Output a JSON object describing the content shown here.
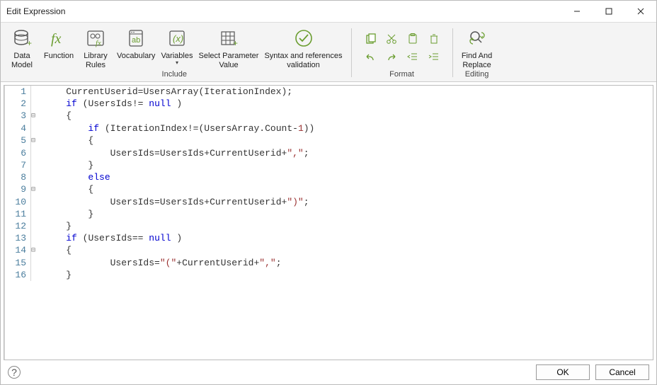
{
  "window": {
    "title": "Edit Expression"
  },
  "include_group": {
    "label": "Include",
    "buttons": {
      "dataModel": "Data\nModel",
      "func": "Function",
      "libRules": "Library\nRules",
      "vocab": "Vocabulary",
      "variables": "Variables",
      "selectParam": "Select Parameter\nValue",
      "syntaxRef": "Syntax and references\nvalidation"
    }
  },
  "format_group": {
    "label": "Format"
  },
  "editing_group": {
    "label": "Editing",
    "findReplace": "Find And\nReplace"
  },
  "footer": {
    "ok": "OK",
    "cancel": "Cancel"
  },
  "code_lines": [
    {
      "n": 1,
      "fold": "",
      "tokens": [
        [
          "id",
          "    CurrentUserid"
        ],
        [
          "punc",
          "="
        ],
        [
          "id",
          "UsersArray"
        ],
        [
          "punc",
          "("
        ],
        [
          "id",
          "IterationIndex"
        ],
        [
          "punc",
          ")"
        ],
        [
          "punc",
          ";"
        ]
      ]
    },
    {
      "n": 2,
      "fold": "",
      "tokens": [
        [
          "id",
          "    "
        ],
        [
          "kw",
          "if"
        ],
        [
          "id",
          " "
        ],
        [
          "punc",
          "("
        ],
        [
          "id",
          "UsersIds"
        ],
        [
          "punc",
          "!="
        ],
        [
          "id",
          " "
        ],
        [
          "kw",
          "null"
        ],
        [
          "id",
          " "
        ],
        [
          "punc",
          ")"
        ]
      ]
    },
    {
      "n": 3,
      "fold": "⊟",
      "tokens": [
        [
          "punc",
          "    {"
        ]
      ]
    },
    {
      "n": 4,
      "fold": "",
      "tokens": [
        [
          "id",
          "        "
        ],
        [
          "kw",
          "if"
        ],
        [
          "id",
          " "
        ],
        [
          "punc",
          "("
        ],
        [
          "id",
          "IterationIndex"
        ],
        [
          "punc",
          "!=("
        ],
        [
          "id",
          "UsersArray"
        ],
        [
          "punc",
          "."
        ],
        [
          "id",
          "Count"
        ],
        [
          "punc",
          "-"
        ],
        [
          "num",
          "1"
        ],
        [
          "punc",
          "))"
        ]
      ]
    },
    {
      "n": 5,
      "fold": "⊟",
      "tokens": [
        [
          "punc",
          "        {"
        ]
      ]
    },
    {
      "n": 6,
      "fold": "",
      "tokens": [
        [
          "id",
          "            UsersIds"
        ],
        [
          "punc",
          "="
        ],
        [
          "id",
          "UsersIds"
        ],
        [
          "punc",
          "+"
        ],
        [
          "id",
          "CurrentUserid"
        ],
        [
          "punc",
          "+"
        ],
        [
          "str",
          "\",\""
        ],
        [
          "punc",
          ";"
        ]
      ]
    },
    {
      "n": 7,
      "fold": "",
      "tokens": [
        [
          "punc",
          "        }"
        ]
      ]
    },
    {
      "n": 8,
      "fold": "",
      "tokens": [
        [
          "id",
          "        "
        ],
        [
          "kw",
          "else"
        ]
      ]
    },
    {
      "n": 9,
      "fold": "⊟",
      "tokens": [
        [
          "punc",
          "        {"
        ]
      ]
    },
    {
      "n": 10,
      "fold": "",
      "tokens": [
        [
          "id",
          "            UsersIds"
        ],
        [
          "punc",
          "="
        ],
        [
          "id",
          "UsersIds"
        ],
        [
          "punc",
          "+"
        ],
        [
          "id",
          "CurrentUserid"
        ],
        [
          "punc",
          "+"
        ],
        [
          "str",
          "\")\""
        ],
        [
          "punc",
          ";"
        ]
      ]
    },
    {
      "n": 11,
      "fold": "",
      "tokens": [
        [
          "punc",
          "        }"
        ]
      ]
    },
    {
      "n": 12,
      "fold": "",
      "tokens": [
        [
          "punc",
          "    }"
        ]
      ]
    },
    {
      "n": 13,
      "fold": "",
      "tokens": [
        [
          "id",
          "    "
        ],
        [
          "kw",
          "if"
        ],
        [
          "id",
          " "
        ],
        [
          "punc",
          "("
        ],
        [
          "id",
          "UsersIds"
        ],
        [
          "punc",
          "=="
        ],
        [
          "id",
          " "
        ],
        [
          "kw",
          "null"
        ],
        [
          "id",
          " "
        ],
        [
          "punc",
          ")"
        ]
      ]
    },
    {
      "n": 14,
      "fold": "⊟",
      "tokens": [
        [
          "punc",
          "    {"
        ]
      ]
    },
    {
      "n": 15,
      "fold": "",
      "tokens": [
        [
          "id",
          "            UsersIds"
        ],
        [
          "punc",
          "="
        ],
        [
          "str",
          "\"(\""
        ],
        [
          "punc",
          "+"
        ],
        [
          "id",
          "CurrentUserid"
        ],
        [
          "punc",
          "+"
        ],
        [
          "str",
          "\",\""
        ],
        [
          "punc",
          ";"
        ]
      ]
    },
    {
      "n": 16,
      "fold": "",
      "tokens": [
        [
          "punc",
          "    }"
        ]
      ]
    }
  ]
}
